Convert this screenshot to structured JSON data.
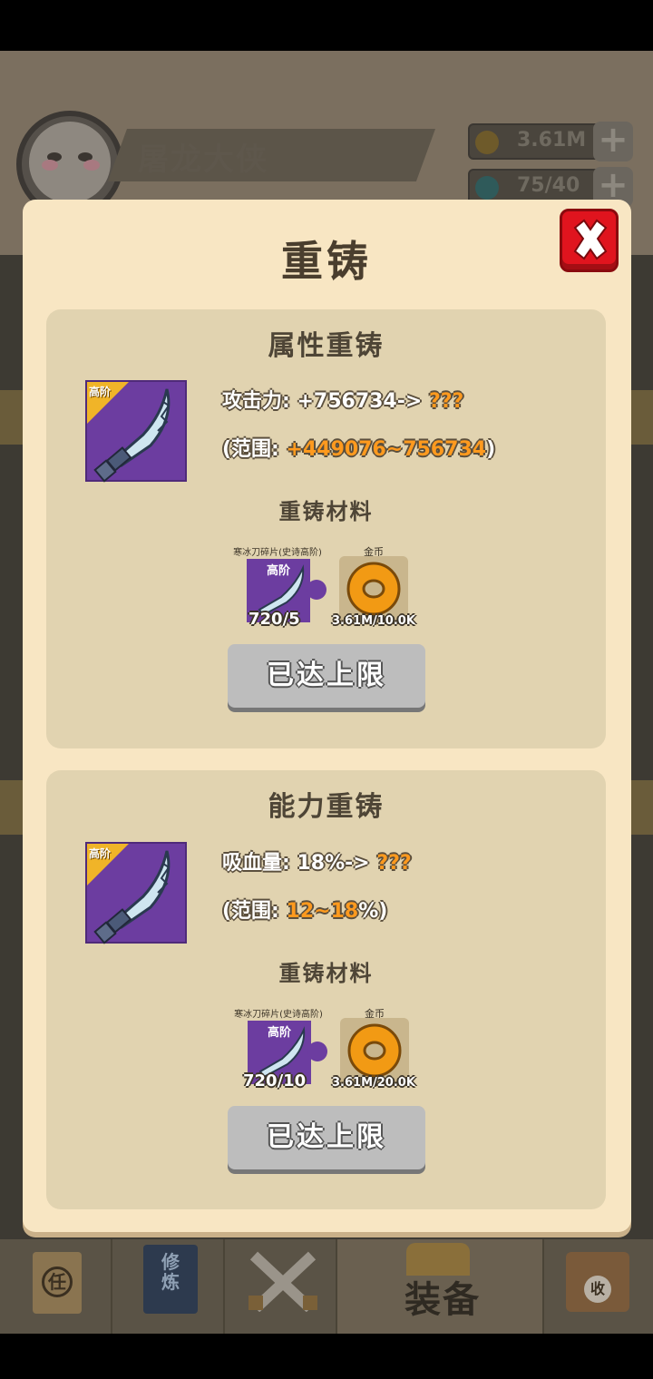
{
  "background": {
    "player_name": "屠龙大侠",
    "gold": "3.61M",
    "gems": "75/40",
    "plus_label": "+",
    "nav": {
      "task_label": "任",
      "train_label": "修炼",
      "equip_label": "装备",
      "collect_label": "收"
    }
  },
  "modal": {
    "title": "重铸",
    "close_icon": "close-x-icon",
    "sections": [
      {
        "title": "属性重铸",
        "weapon_tier": "高阶",
        "stat_label": "攻击力: +756734->",
        "stat_unknown": "???",
        "range_prefix": "(范围: ",
        "range_value": "+449076~756734",
        "range_suffix": ")",
        "materials_title": "重铸材料",
        "fragment_name": "寒冰刀碎片(史诗高阶)",
        "fragment_tier": "高阶",
        "fragment_count": "720/5",
        "coin_name": "金币",
        "coin_count": "3.61M/10.0K",
        "button_label": "已达上限"
      },
      {
        "title": "能力重铸",
        "weapon_tier": "高阶",
        "stat_label": "吸血量: 18%->",
        "stat_unknown": "???",
        "range_prefix": "(范围: ",
        "range_value": "12~18",
        "range_suffix": "%)",
        "materials_title": "重铸材料",
        "fragment_name": "寒冰刀碎片(史诗高阶)",
        "fragment_tier": "高阶",
        "fragment_count": "720/10",
        "coin_name": "金币",
        "coin_count": "3.61M/20.0K",
        "button_label": "已达上限"
      }
    ]
  },
  "colors": {
    "panel_bg": "#f8e6c3",
    "section_bg": "#e1d3b0",
    "highlight_orange": "#ff9a1e",
    "close_red": "#e0141e",
    "weapon_purple": "#6c3da0",
    "tier_gold": "#f0b428",
    "disabled_button": "#bdbdbd"
  }
}
